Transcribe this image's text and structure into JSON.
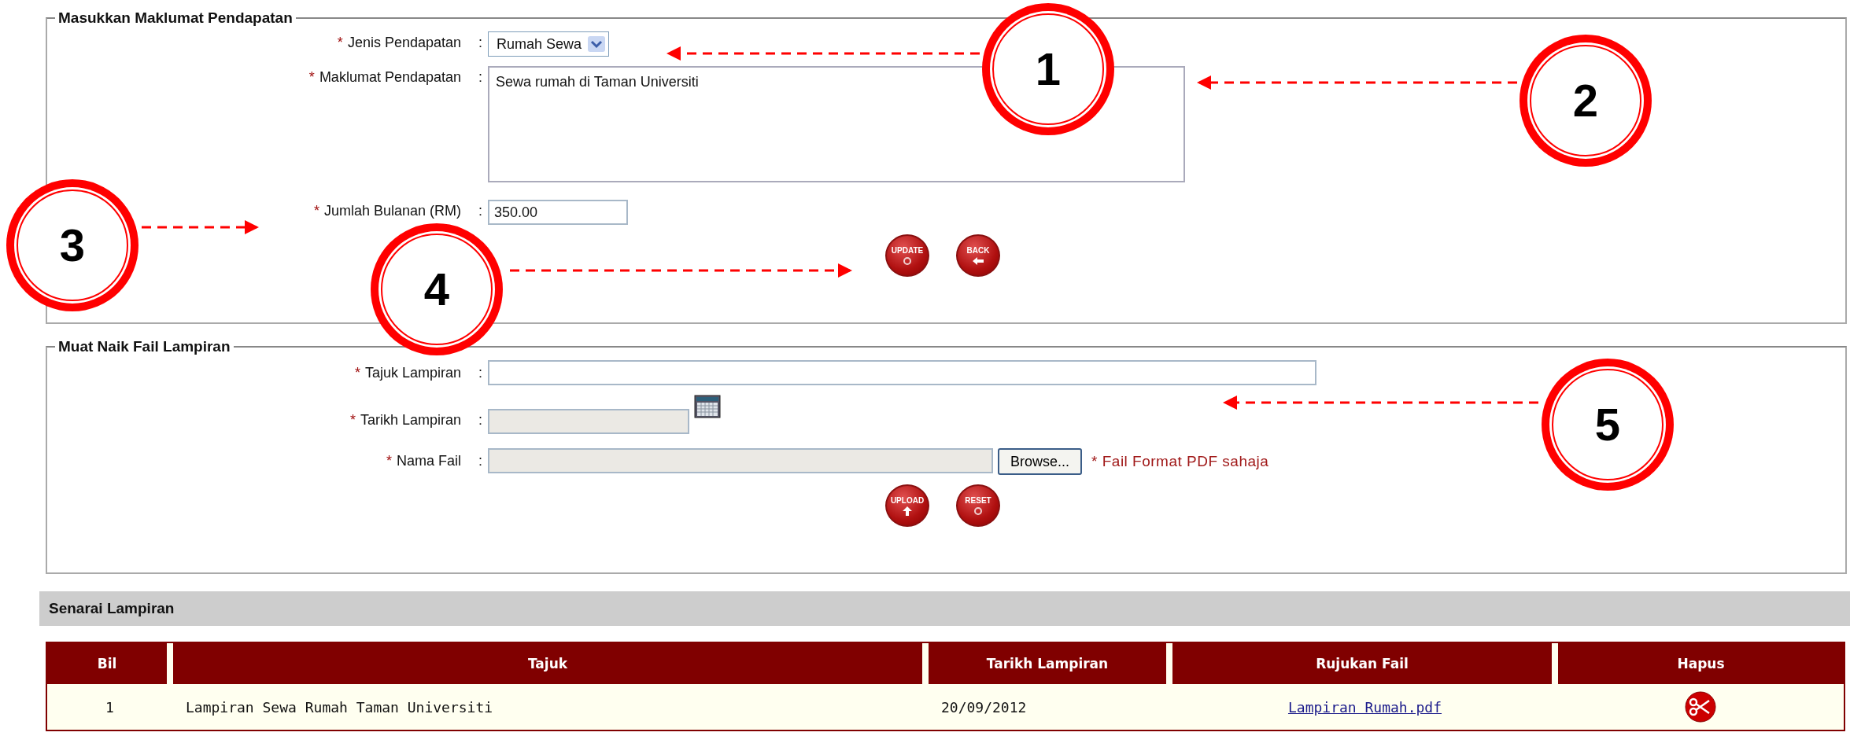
{
  "income_section": {
    "legend": "Masukkan Maklumat Pendapatan",
    "fields": [
      {
        "kind": "select",
        "required_mark": "*",
        "label": "Jenis Pendapatan",
        "separator": ":",
        "value": "Rumah Sewa"
      },
      {
        "kind": "textarea",
        "required_mark": "*",
        "label": "Maklumat Pendapatan",
        "separator": ":",
        "value": "Sewa rumah di Taman Universiti"
      },
      {
        "kind": "input",
        "required_mark": "*",
        "label": "Jumlah Bulanan (RM)",
        "separator": ":",
        "value": "350.00"
      }
    ],
    "buttons": [
      {
        "label": "UPDATE",
        "kind": "update"
      },
      {
        "label": "BACK",
        "kind": "back"
      }
    ]
  },
  "upload_section": {
    "legend": "Muat Naik Fail Lampiran",
    "fields": [
      {
        "kind": "input",
        "required_mark": "*",
        "label": "Tajuk Lampiran",
        "separator": ":"
      },
      {
        "kind": "date",
        "required_mark": "*",
        "label": "Tarikh Lampiran",
        "separator": ":",
        "disabled": true
      },
      {
        "kind": "file",
        "required_mark": "*",
        "label": "Nama Fail",
        "separator": ":",
        "disabled": true,
        "button": "Browse...",
        "note": "* Fail Format PDF sahaja"
      }
    ],
    "buttons": [
      {
        "label": "UPLOAD",
        "kind": "upload"
      },
      {
        "label": "RESET",
        "kind": "reset"
      }
    ]
  },
  "attachments": {
    "title": "Senarai Lampiran",
    "columns": [
      "Bil",
      "Tajuk",
      "Tarikh Lampiran",
      "Rujukan Fail",
      "Hapus"
    ],
    "rows": [
      {
        "bil": "1",
        "tajuk": "Lampiran Sewa Rumah Taman Universiti",
        "tarikh": "20/09/2012",
        "file": "Lampiran Rumah.pdf"
      }
    ]
  },
  "callouts": [
    {
      "number": "1"
    },
    {
      "number": "2"
    },
    {
      "number": "3"
    },
    {
      "number": "4"
    },
    {
      "number": "5"
    }
  ]
}
